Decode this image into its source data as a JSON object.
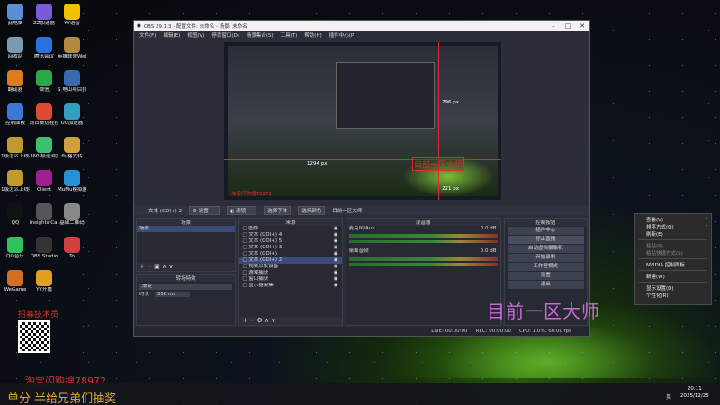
{
  "desktop": {
    "icons": [
      {
        "label": "此电脑",
        "color": "#5a8fd6"
      },
      {
        "label": "ZZ加速器",
        "color": "#7a5ad6"
      },
      {
        "label": "YY语音",
        "color": "#f2c100"
      },
      {
        "label": "回收站",
        "color": "#7a9ab0"
      },
      {
        "label": "腾讯会议",
        "color": "#2a72e0"
      },
      {
        "label": "英雄联盟WeGame版",
        "color": "#b08a40"
      },
      {
        "label": "翻译器",
        "color": "#e07a20"
      },
      {
        "label": "微信",
        "color": "#2aa84a"
      },
      {
        "label": "S 电山项目打到运费值",
        "color": "#3a6ab0"
      },
      {
        "label": "控制面板",
        "color": "#3a7ad6"
      },
      {
        "label": "向日葵远程控制",
        "color": "#e04a30"
      },
      {
        "label": "UU加速器",
        "color": "#30a0c0"
      },
      {
        "label": "1级怎么上线不被骗",
        "color": "#c09a30"
      },
      {
        "label": "360 极速浏览器X",
        "color": "#3ac070"
      },
      {
        "label": "flv格式转",
        "color": "#d0a040"
      },
      {
        "label": "1级怎么上线被骗图",
        "color": "#c09a30"
      },
      {
        "label": "Client",
        "color": "#a02090"
      },
      {
        "label": "MuMu模拟器",
        "color": "#2a90d6"
      },
      {
        "label": "QQ",
        "color": "#111111"
      },
      {
        "label": "Insights Capture",
        "color": "#555555"
      },
      {
        "label": "基础二维码",
        "color": "#888888"
      },
      {
        "label": "QQ音乐",
        "color": "#30c060"
      },
      {
        "label": "OBS Studio",
        "color": "#333333"
      },
      {
        "label": "To",
        "color": "#d04040"
      },
      {
        "label": "WeGame",
        "color": "#d07020"
      },
      {
        "label": "YY开播",
        "color": "#e0a020"
      }
    ],
    "overlay_text_red_top": "招募技术员",
    "overlay_promo_red": "淘宝闪购搜78972",
    "overlay_bottom_orange": "单分 半给兄弟们抽奖",
    "big_purple_text": "目前一区大师"
  },
  "obs": {
    "title": "OBS 29.1.3 - 配置文件: 未命名 - 场景: 未命名",
    "menu": [
      "文件(F)",
      "编辑(E)",
      "视图(V)",
      "停靠窗口(D)",
      "场景集合(S)",
      "工具(T)",
      "帮助(H)",
      "插件中心(P)"
    ],
    "preview_labels": {
      "px_top": "796 px",
      "px_left": "1294 px",
      "px_bottom": "221 px",
      "red_box": "目前一区大师",
      "overlay1": "淘宝闪购搜78972",
      "overlay2": "单分 半给兄弟们抽奖"
    },
    "source_strip": {
      "selected": "文本 (GDI+) 2",
      "settings": "设置",
      "filters": "滤镜",
      "fonts": "选择字体",
      "color": "选择颜色",
      "text_value": "目前一区大师"
    },
    "scenes": {
      "header": "场景",
      "items": [
        "场景"
      ]
    },
    "transition": {
      "header": "转场特效",
      "type": "渐变",
      "duration_label": "时长",
      "duration": "350 ms"
    },
    "sources": {
      "header": "来源",
      "items": [
        "图像",
        "文本 (GDI+) 4",
        "文本 (GDI+) 5",
        "文本 (GDI+) 3",
        "文本 (GDI+)",
        "文本 (GDI+) 2",
        "视频采集设备",
        "游戏捕获",
        "窗口捕获",
        "显示器采集"
      ]
    },
    "mixer": {
      "header": "混音器",
      "tracks": [
        {
          "name": "麦克风/Aux",
          "db": "0.0 dB"
        },
        {
          "name": "桌面音频",
          "db": "0.0 dB"
        }
      ]
    },
    "controls": {
      "header": "控制按钮",
      "buttons": [
        "插件中心",
        "停止直播",
        "启动虚拟摄像机",
        "开始录制",
        "工作室模式",
        "设置",
        "退出"
      ]
    },
    "status": {
      "live": "LIVE: 00:00:00",
      "rec": "REC: 00:00:00",
      "cpu": "CPU: 1.0%, 60.00 fps"
    }
  },
  "context_menu": {
    "items": [
      {
        "label": "查看(V)",
        "arrow": true,
        "enabled": true
      },
      {
        "label": "排序方式(O)",
        "arrow": true,
        "enabled": true
      },
      {
        "label": "刷新(E)",
        "arrow": false,
        "enabled": true
      },
      {
        "label": "粘贴(P)",
        "arrow": false,
        "enabled": false
      },
      {
        "label": "粘贴快捷方式(S)",
        "arrow": false,
        "enabled": false
      },
      {
        "label": "NVIDIA 控制面板",
        "arrow": false,
        "enabled": true
      },
      {
        "label": "新建(W)",
        "arrow": true,
        "enabled": true
      },
      {
        "label": "显示设置(D)",
        "arrow": false,
        "enabled": true
      },
      {
        "label": "个性化(R)",
        "arrow": false,
        "enabled": true
      }
    ]
  },
  "taskbar": {
    "time": "20:11",
    "date": "2025/12/25",
    "lang": "英"
  }
}
